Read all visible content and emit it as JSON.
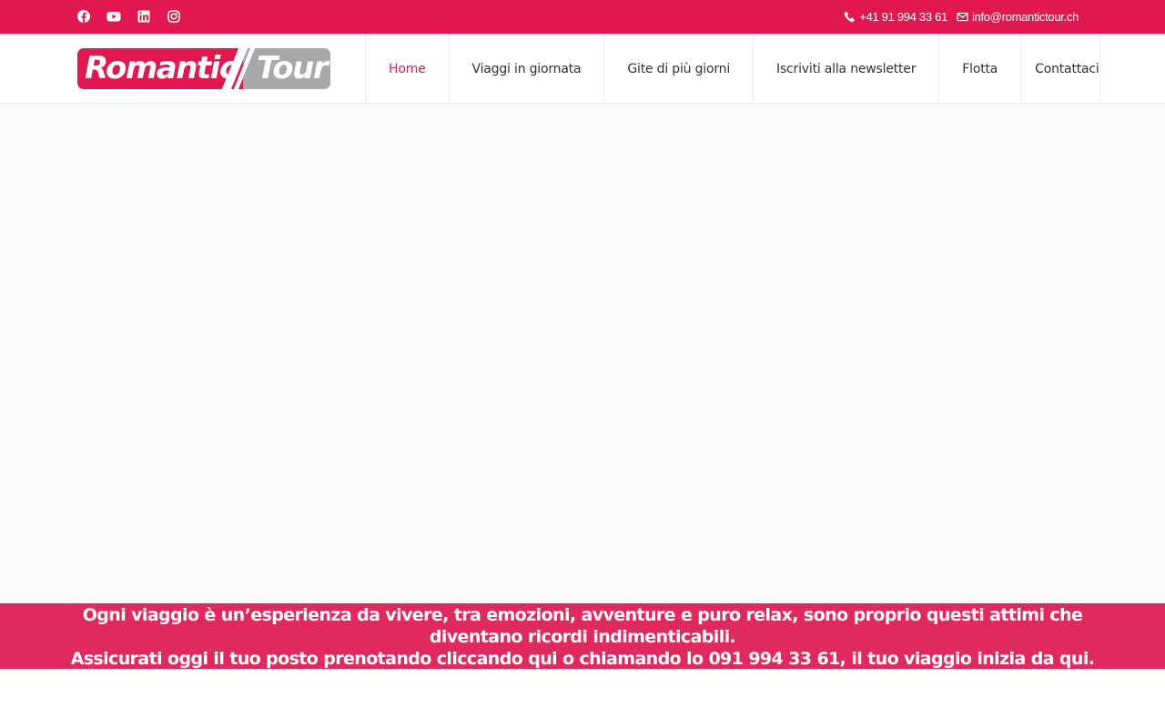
{
  "topbar": {
    "social": [
      "facebook-icon",
      "youtube-icon",
      "linkedin-icon",
      "instagram-icon"
    ],
    "phone": "+41 91 994 33 61",
    "email": "info@romantictour.ch",
    "bg_color": "#e0184f"
  },
  "logo": {
    "left_text": "Romantic",
    "right_text": "Tour",
    "left_color": "#e0184f",
    "right_color": "#a8a8a8"
  },
  "nav": {
    "items": [
      {
        "label": "Home",
        "active": true
      },
      {
        "label": "Viaggi in giornata",
        "active": false
      },
      {
        "label": "Gite di più giorni",
        "active": false
      },
      {
        "label": "Iscriviti alla newsletter",
        "active": false
      },
      {
        "label": "Flotta",
        "active": false
      },
      {
        "label": "Contattaci",
        "active": false
      }
    ],
    "active_color": "#e0184f"
  },
  "banner": {
    "line1": "Ogni viaggio è un’esperienza da vivere, tra emozioni, avventure e puro relax, sono proprio questi attimi che diventano ricordi indimenticabili.",
    "line2": "Assicurati oggi il tuo posto prenotando cliccando qui o chiamando lo 091 994 33 61, il tuo viaggio inizia da qui.",
    "bg_color": "#e02a5e"
  }
}
